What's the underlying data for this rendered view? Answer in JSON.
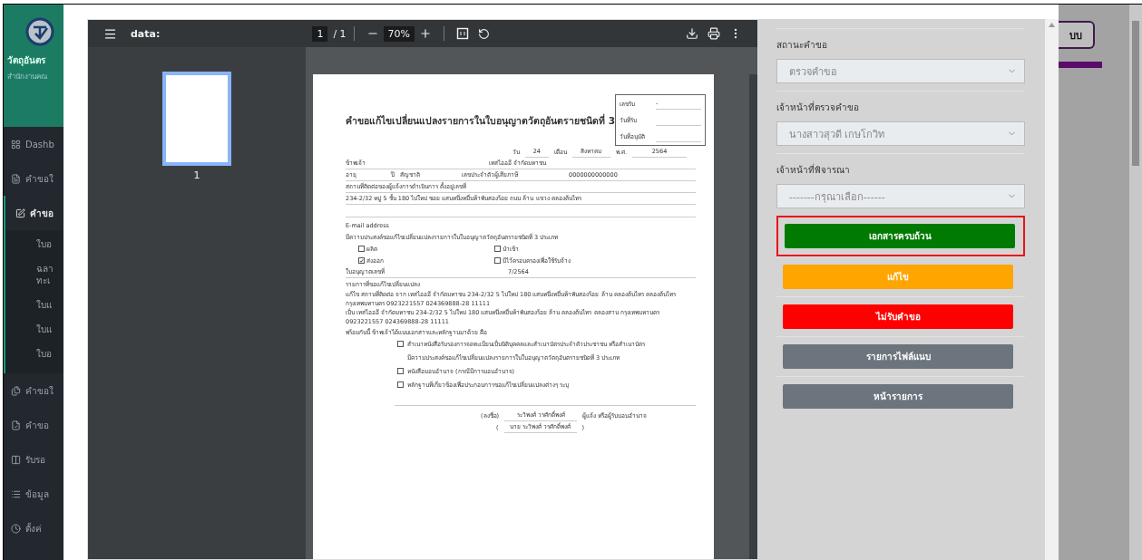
{
  "sidebar": {
    "brand_title": "วัตถุอันตร",
    "brand_subtitle": "สำนักงานคณ",
    "items": [
      {
        "label": "Dashb",
        "selected": false
      },
      {
        "label": "คำขอใ",
        "selected": false
      },
      {
        "label": "คำขอ",
        "selected": true,
        "expanded": true,
        "children": [
          {
            "lines": [
              "ใบอ"
            ]
          },
          {
            "lines": [
              "ฉลา",
              "ทะเ"
            ]
          },
          {
            "lines": [
              "ใบแ"
            ]
          },
          {
            "lines": [
              "ใบแ"
            ]
          },
          {
            "lines": [
              "ใบอ"
            ]
          }
        ]
      },
      {
        "label": "คำขอใ",
        "selected": false
      },
      {
        "label": "คำขอ",
        "selected": false
      },
      {
        "label": "รับรอ",
        "selected": false
      },
      {
        "label": "ข้อมูล",
        "selected": false
      },
      {
        "label": "ตั้งค่",
        "selected": false
      }
    ]
  },
  "pdf_viewer": {
    "file_name": "data:",
    "page": "1",
    "page_total": "/ 1",
    "zoom": "70%",
    "thumbnails": [
      {
        "label": "1",
        "selected": true
      }
    ],
    "document": {
      "title": "คำขอแก้ไขเปลี่ยนแปลงรายการในใบอนุญาตวัตถุอันตรายชนิดที่ 3",
      "receipt_box": [
        {
          "label": "เลขรับ",
          "value": "-"
        },
        {
          "label": "วันที่รับ"
        },
        {
          "label": "วันที่อนุมัติ"
        }
      ],
      "date": {
        "day_label": "วัน",
        "day": "24",
        "month_label": "เดือน",
        "month": "สิงหาคม",
        "year_label": "พ.ศ.",
        "year": "2564"
      },
      "applicant": {
        "label": "ข้าพเจ้า",
        "value": "เทสไอออี จำกัดมหาชน"
      },
      "age_row": {
        "age_label": "อายุ",
        "year_unit": "ปี",
        "nationality_label": "สัญชาติ",
        "tax_id_label": "เลขประจำตัวผู้เสียภาษี",
        "tax_id": "0000000000000"
      },
      "address_label": "สถานที่ติดต่อของผู้แจ้งการดำเนินการ ตั้งอยู่เลขที่",
      "address": "234-2/32 หมู่ 5  ชั้น 180 ไปใหม่ ซอย แสนหนึ่งหมื่นห้าพันสองร้อย ถนน ล้าน แขวง คลองต้นไทร",
      "email_label": "E-mail address",
      "purpose": "มีความประสงค์ขอแก้ไขเปลี่ยนแปลงรายการในใบอนุญาตวัตถุอันตรายชนิดที่ 3 ประเภท",
      "types": [
        {
          "label": "ผลิต",
          "checked": false
        },
        {
          "label": "นำเข้า",
          "checked": false
        },
        {
          "label": "ส่งออก",
          "checked": true
        },
        {
          "label": "มีไว้ครอบครองเพื่อใช้รับจ้าง",
          "checked": false
        }
      ],
      "license": {
        "label": "ใบอนุญาตเลขที่",
        "value": "7/2564"
      },
      "changes_label": "รายการที่ขอแก้ไขเปลี่ยนแปลง",
      "changes": [
        {
          "label": "แก้ไข",
          "text": "สถานที่ติดต่อ จาก  เทสไอออี จำกัดมหาชน 234-2/32 5  ไปใหม่ 180 แสนหนึ่งหมื่นห้าพันสองร้อย ล้าน คลองต้นไทร คลองต้นไทร กรุงเทพมหานคร 0923221557 024369888-28 11111"
        },
        {
          "label": "เป็น",
          "text": "เทสไอออี จำกัดมหาชน 234-2/32 5 ไปใหม่ 180 แสนหนึ่งหมื่นห้าพันสองร้อย ล้าน คลองต้นไทร คลองสาน กรุงเทพมหานคร 0923221557 024369888-28 11111"
        }
      ],
      "attachments_label": "พร้อมกันนี้ ข้าพเจ้าได้แนบเอกสารและหลักฐานมาด้วย คือ",
      "attachments": [
        {
          "kind": "checkbox",
          "label": "สำเนาหนังสือรับรองการจดทะเบียนเป็นนิติบุคคลและสำเนาบัตรประจำตัวประชาชน หรือสำเนาบัตร",
          "checked": false
        },
        {
          "kind": "note",
          "label": "มีความประสงค์ขอแก้ไขเปลี่ยนแปลงรายการในใบอนุญาตวัตถุอันตรายชนิดที่ 3 ประเภท"
        },
        {
          "kind": "checkbox",
          "label": "หนังสือมอบอำนาจ (กรณีมีการมอบอำนาจ)",
          "checked": false
        },
        {
          "kind": "checkbox",
          "label": "หลักฐานที่เกี่ยวข้องเพื่อประกอบการขอแก้ไขเปลี่ยนแปลงต่างๆ ระบุ",
          "checked": false
        }
      ],
      "signature": {
        "sign_label": "(ลงชื่อ)",
        "signer": "ระวิพงศ์  วรศักดิ์พงศ์",
        "role": "ผู้แจ้ง หรือผู้รับมอบอำนาจ",
        "open_paren": "(",
        "name": "นาย ระวิพงศ์  วรศักดิ์พงศ์",
        "close_paren": ")"
      }
    }
  },
  "review_panel": {
    "fields": [
      {
        "label": "สถานะคำขอ",
        "value": "ตรวจคำขอ",
        "disabled": true
      },
      {
        "label": "เจ้าหน้าที่ตรวจคำขอ",
        "value": "นางสาวสุวดี เกษโกวิท",
        "disabled": true
      },
      {
        "label": "เจ้าหน้าที่พิจารณา",
        "value": "-------กรุณาเลือก------",
        "disabled": true
      }
    ],
    "buttons": [
      {
        "label": "เอกสารครบถ้วน",
        "color": "#007a00",
        "highlighted": true
      },
      {
        "label": "แก้ไข",
        "color": "#ffa500",
        "highlighted": false
      },
      {
        "label": "ไม่รับคำขอ",
        "color": "#ff0000",
        "highlighted": false
      },
      {
        "label": "รายการไฟล์แนบ",
        "color": "#6c757d",
        "highlighted": false
      },
      {
        "label": "หน้ารายการ",
        "color": "#6c757d",
        "highlighted": false
      }
    ]
  },
  "background_page": {
    "button_label": "บบ"
  }
}
